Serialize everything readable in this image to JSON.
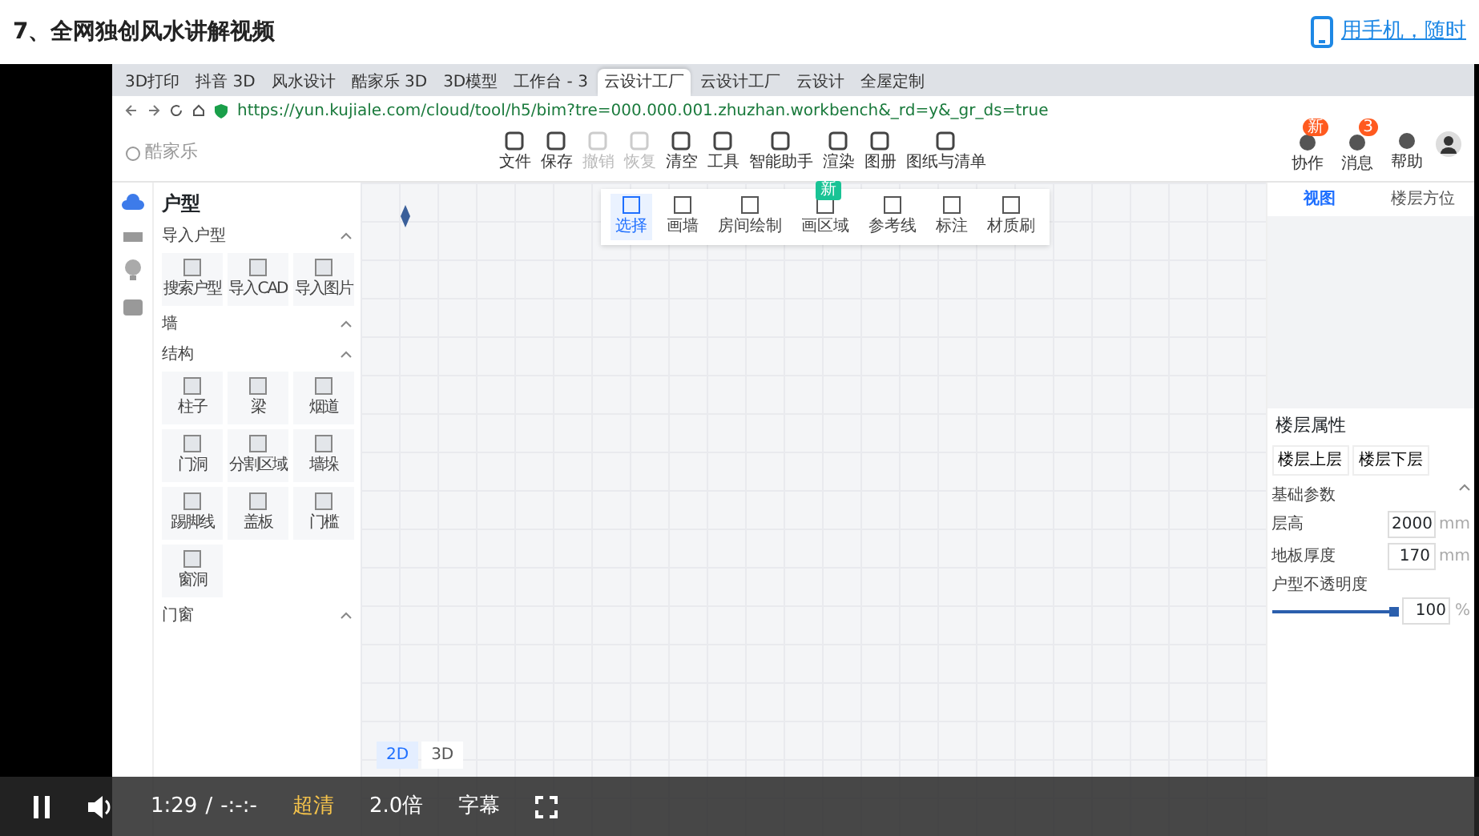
{
  "page": {
    "title": "7、全网独创风水讲解视频",
    "mobile_link": "用手机，随时"
  },
  "browser": {
    "tabs": [
      {
        "label": "3D打印",
        "selected": false
      },
      {
        "label": "抖音 3D",
        "selected": false
      },
      {
        "label": "风水设计",
        "selected": false
      },
      {
        "label": "酷家乐 3D",
        "selected": false
      },
      {
        "label": "3D模型",
        "selected": false
      },
      {
        "label": "工作台 - 3",
        "selected": false
      },
      {
        "label": "云设计工厂",
        "selected": true
      },
      {
        "label": "云设计工厂",
        "selected": false
      },
      {
        "label": "云设计",
        "selected": false
      },
      {
        "label": "全屋定制",
        "selected": false
      }
    ],
    "url": "https://yun.kujiale.com/cloud/tool/h5/bim?tre=000.000.001.zhuzhan.workbench&_rd=y&_gr_ds=true"
  },
  "app": {
    "logo": "酷家乐",
    "toolbar": [
      {
        "label": "文件",
        "disabled": false
      },
      {
        "label": "保存",
        "disabled": false
      },
      {
        "label": "撤销",
        "disabled": true
      },
      {
        "label": "恢复",
        "disabled": true
      },
      {
        "label": "清空",
        "disabled": false
      },
      {
        "label": "工具",
        "disabled": false
      },
      {
        "label": "智能助手",
        "disabled": false
      },
      {
        "label": "渲染",
        "disabled": false
      },
      {
        "label": "图册",
        "disabled": false
      },
      {
        "label": "图纸与清单",
        "disabled": false
      }
    ],
    "mode_tools": [
      {
        "label": "选择",
        "selected": true
      },
      {
        "label": "画墙",
        "selected": false
      },
      {
        "label": "房间绘制",
        "selected": false
      },
      {
        "label": "画区域",
        "selected": false,
        "badge": "新"
      },
      {
        "label": "参考线",
        "selected": false
      },
      {
        "label": "标注",
        "selected": false
      },
      {
        "label": "材质刷",
        "selected": false
      }
    ],
    "account": [
      {
        "label": "协作",
        "badge": "新"
      },
      {
        "label": "消息",
        "badge": "3"
      },
      {
        "label": "帮助"
      }
    ]
  },
  "sidebar": {
    "title": "户型",
    "sections": [
      {
        "title": "导入户型",
        "items": [
          "搜索户型",
          "导入CAD",
          "导入图片"
        ]
      },
      {
        "title": "墙"
      },
      {
        "title": "结构",
        "items": [
          "柱子",
          "梁",
          "烟道",
          "门洞",
          "分割区域",
          "墙垛",
          "踢脚线",
          "盖板",
          "门槛",
          "窗洞"
        ]
      },
      {
        "title": "门窗"
      }
    ]
  },
  "right_panel": {
    "tabs": [
      {
        "label": "视图",
        "selected": true
      },
      {
        "label": "楼层方位",
        "selected": false
      }
    ],
    "properties_title": "楼层属性",
    "floor_buttons": [
      "楼层上层",
      "楼层下层"
    ],
    "section": "基础参数",
    "fields": [
      {
        "label": "层高",
        "value": "2000",
        "unit": "mm"
      },
      {
        "label": "地板厚度",
        "value": "170",
        "unit": "mm"
      }
    ],
    "opacity": {
      "label": "户型不透明度",
      "level": 1,
      "value": "100",
      "unit": "%"
    }
  },
  "view_switch": [
    {
      "label": "2D",
      "selected": true
    },
    {
      "label": "3D",
      "selected": false
    }
  ],
  "player": {
    "playing": true,
    "time": "1:29",
    "separator": "/",
    "duration": "-:-:-",
    "quality": "超清",
    "speed": "2.0倍",
    "subtitles": "字幕"
  }
}
